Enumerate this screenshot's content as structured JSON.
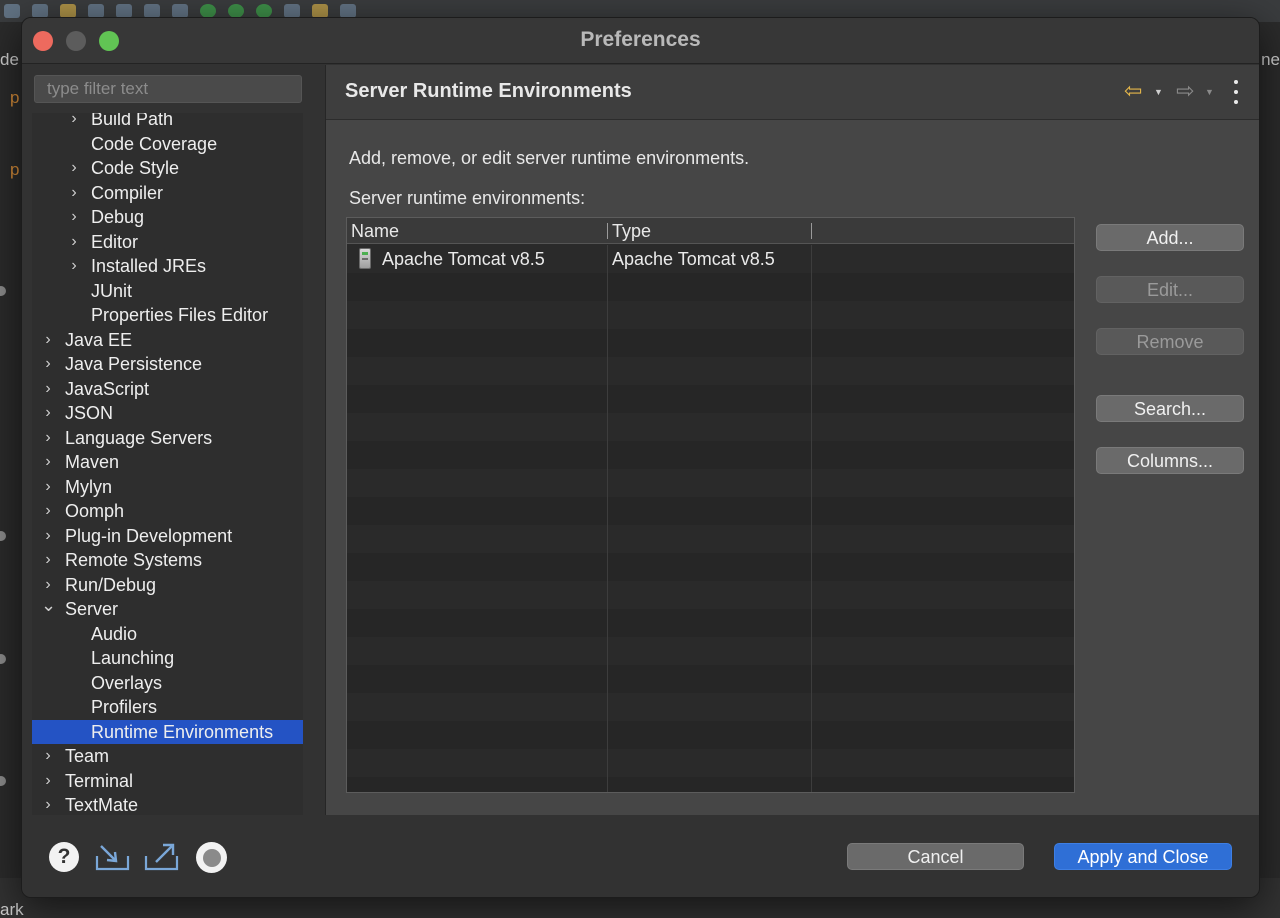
{
  "background_ide": {
    "left_text": "de",
    "right_text": "ne",
    "bottom_text": "ark",
    "orange_glyph": "p"
  },
  "window": {
    "title": "Preferences"
  },
  "filter": {
    "placeholder": "type filter text"
  },
  "tree": {
    "items": [
      {
        "label": "Build Path",
        "level": 1,
        "chevron": "right"
      },
      {
        "label": "Code Coverage",
        "level": 1,
        "chevron": "none"
      },
      {
        "label": "Code Style",
        "level": 1,
        "chevron": "right"
      },
      {
        "label": "Compiler",
        "level": 1,
        "chevron": "right"
      },
      {
        "label": "Debug",
        "level": 1,
        "chevron": "right"
      },
      {
        "label": "Editor",
        "level": 1,
        "chevron": "right"
      },
      {
        "label": "Installed JREs",
        "level": 1,
        "chevron": "right"
      },
      {
        "label": "JUnit",
        "level": 1,
        "chevron": "none"
      },
      {
        "label": "Properties Files Editor",
        "level": 1,
        "chevron": "none"
      },
      {
        "label": "Java EE",
        "level": 0,
        "chevron": "right"
      },
      {
        "label": "Java Persistence",
        "level": 0,
        "chevron": "right"
      },
      {
        "label": "JavaScript",
        "level": 0,
        "chevron": "right"
      },
      {
        "label": "JSON",
        "level": 0,
        "chevron": "right"
      },
      {
        "label": "Language Servers",
        "level": 0,
        "chevron": "right"
      },
      {
        "label": "Maven",
        "level": 0,
        "chevron": "right"
      },
      {
        "label": "Mylyn",
        "level": 0,
        "chevron": "right"
      },
      {
        "label": "Oomph",
        "level": 0,
        "chevron": "right"
      },
      {
        "label": "Plug-in Development",
        "level": 0,
        "chevron": "right"
      },
      {
        "label": "Remote Systems",
        "level": 0,
        "chevron": "right"
      },
      {
        "label": "Run/Debug",
        "level": 0,
        "chevron": "right"
      },
      {
        "label": "Server",
        "level": 0,
        "chevron": "down"
      },
      {
        "label": "Audio",
        "level": 1,
        "chevron": "none"
      },
      {
        "label": "Launching",
        "level": 1,
        "chevron": "none"
      },
      {
        "label": "Overlays",
        "level": 1,
        "chevron": "none"
      },
      {
        "label": "Profilers",
        "level": 1,
        "chevron": "none"
      },
      {
        "label": "Runtime Environments",
        "level": 1,
        "chevron": "none",
        "selected": true
      },
      {
        "label": "Team",
        "level": 0,
        "chevron": "right"
      },
      {
        "label": "Terminal",
        "level": 0,
        "chevron": "right"
      },
      {
        "label": "TextMate",
        "level": 0,
        "chevron": "right"
      }
    ]
  },
  "page": {
    "title": "Server Runtime Environments",
    "description": "Add, remove, or edit server runtime environments.",
    "list_label": "Server runtime environments:",
    "nav_back_icon": "back-arrow-icon",
    "nav_forward_icon": "forward-arrow-icon"
  },
  "table": {
    "columns": [
      "Name",
      "Type"
    ],
    "rows": [
      {
        "name": "Apache Tomcat v8.5",
        "type": "Apache Tomcat v8.5",
        "icon": "server-icon"
      }
    ]
  },
  "buttons": {
    "add": "Add...",
    "edit": "Edit...",
    "remove": "Remove",
    "search": "Search...",
    "columns": "Columns..."
  },
  "footer": {
    "help_glyph": "?",
    "cancel": "Cancel",
    "apply_close": "Apply and Close"
  },
  "colors": {
    "accent": "#2f6fd6",
    "selection": "#2453c4",
    "nav_back": "#e4b64a"
  }
}
